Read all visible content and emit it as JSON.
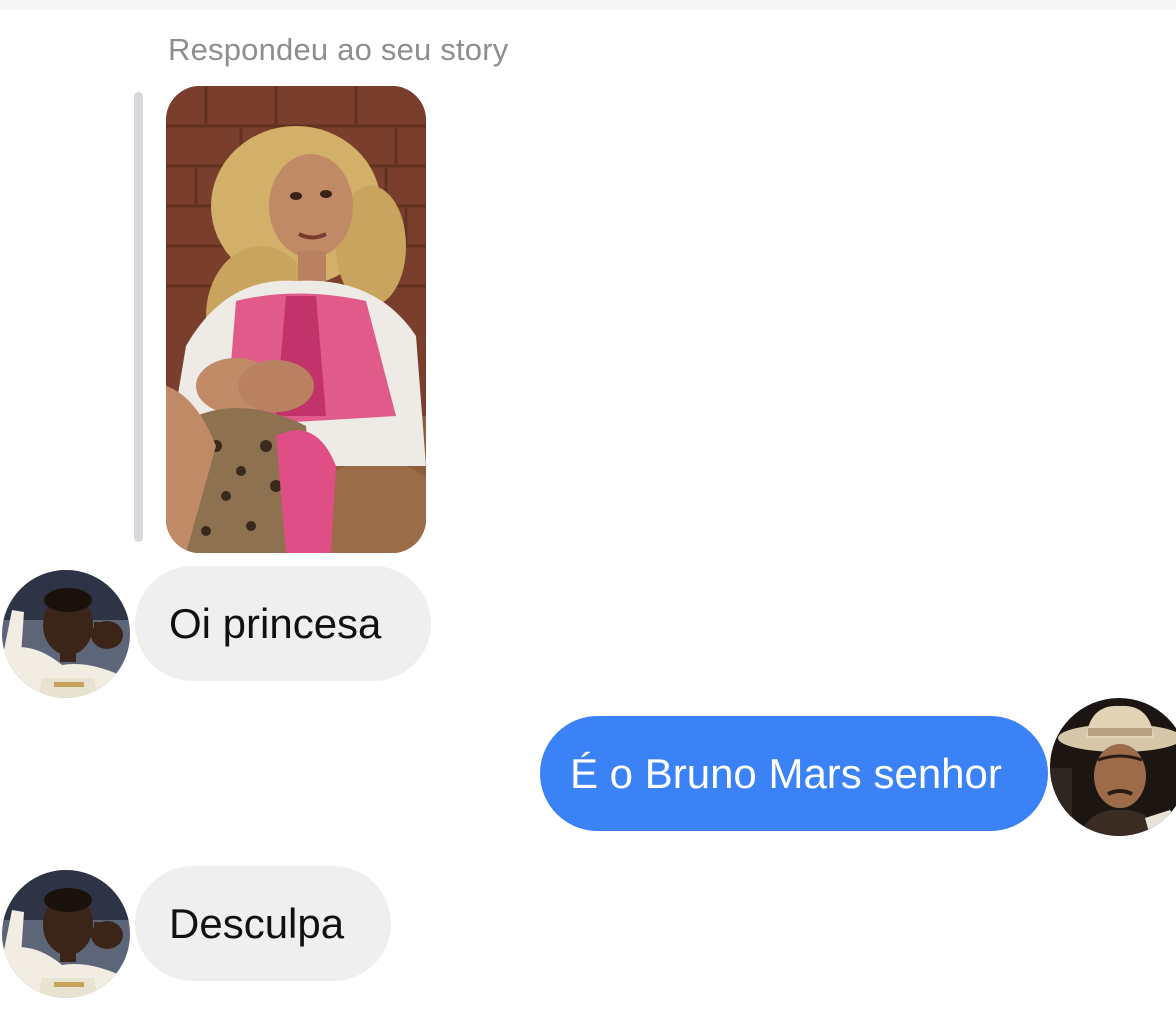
{
  "thread": {
    "story_reply_caption": "Respondeu ao seu story",
    "story_image": {
      "icon": "story-photo",
      "description_icon": "woman-pink-jacket-photo"
    },
    "messages": [
      {
        "sender": "them",
        "text": "Oi princesa",
        "avatar_icon": "footballer-avatar-icon"
      },
      {
        "sender": "me",
        "text": "É o Bruno Mars senhor",
        "avatar_icon": "cowboy-hat-avatar-icon"
      },
      {
        "sender": "them",
        "text": "Desculpa",
        "avatar_icon": "footballer-avatar-icon"
      }
    ]
  },
  "colors": {
    "incoming_bubble": "#efefef",
    "outgoing_bubble": "#3b82f6",
    "caption_text": "#8e8e8e",
    "quote_bar": "#d8d8dc"
  }
}
